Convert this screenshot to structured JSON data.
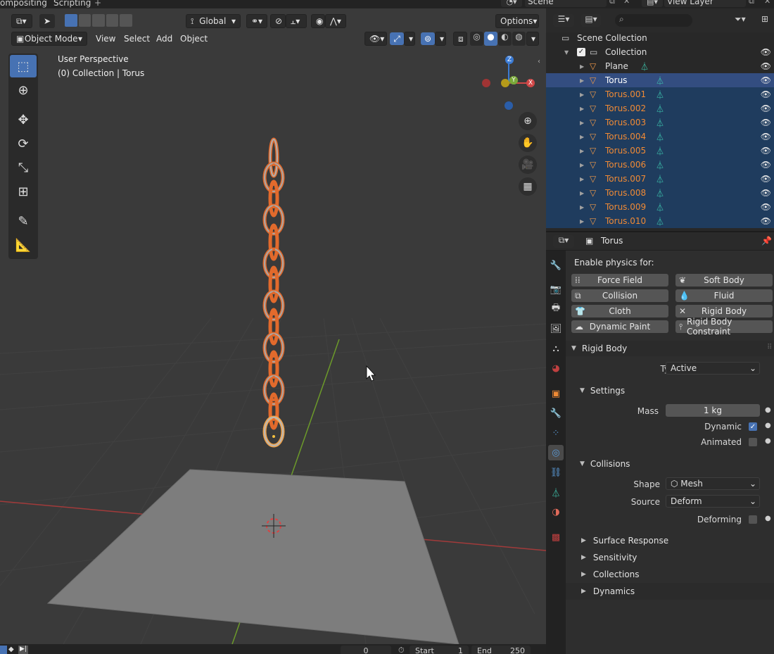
{
  "workspace_tabs": [
    "ompositing",
    "Scripting"
  ],
  "top_right": {
    "scene": "Scene",
    "view_layer": "View Layer"
  },
  "viewport": {
    "mode": "Object Mode",
    "menus": [
      "View",
      "Select",
      "Add",
      "Object"
    ],
    "transform_orientation": "Global",
    "options": "Options",
    "perspective_label": "User Perspective",
    "collection_label": "(0) Collection | Torus",
    "gizmo_axes": {
      "z": "Z",
      "y": "Y",
      "x": "X"
    }
  },
  "timeline": {
    "frame": "0",
    "start_label": "Start",
    "start": "1",
    "end_label": "End",
    "end": "250"
  },
  "outliner": {
    "root": "Scene Collection",
    "collection": "Collection",
    "items": [
      {
        "name": "Plane",
        "state": "normal"
      },
      {
        "name": "Torus",
        "state": "active"
      },
      {
        "name": "Torus.001",
        "state": "selected"
      },
      {
        "name": "Torus.002",
        "state": "selected"
      },
      {
        "name": "Torus.003",
        "state": "selected"
      },
      {
        "name": "Torus.004",
        "state": "selected"
      },
      {
        "name": "Torus.005",
        "state": "selected"
      },
      {
        "name": "Torus.006",
        "state": "selected"
      },
      {
        "name": "Torus.007",
        "state": "selected"
      },
      {
        "name": "Torus.008",
        "state": "selected"
      },
      {
        "name": "Torus.009",
        "state": "selected"
      },
      {
        "name": "Torus.010",
        "state": "selected"
      }
    ]
  },
  "properties": {
    "object_name": "Torus",
    "enable_physics_label": "Enable physics for:",
    "physics_buttons": {
      "force_field": "Force Field",
      "soft_body": "Soft Body",
      "collision": "Collision",
      "fluid": "Fluid",
      "cloth": "Cloth",
      "rigid_body": "Rigid Body",
      "dynamic_paint": "Dynamic Paint",
      "rigid_body_constraint": "Rigid Body Constraint"
    },
    "rigid_body_panel": "Rigid Body",
    "type_label": "Type",
    "type_value": "Active",
    "settings_panel": "Settings",
    "mass_label": "Mass",
    "mass_value": "1 kg",
    "dynamic_label": "Dynamic",
    "animated_label": "Animated",
    "collisions_panel": "Collisions",
    "shape_label": "Shape",
    "shape_value": "Mesh",
    "source_label": "Source",
    "source_value": "Deform",
    "deforming_label": "Deforming",
    "subpanels": [
      "Surface Response",
      "Sensitivity",
      "Collections",
      "Dynamics"
    ]
  },
  "colors": {
    "selection_blue": "#4772b3",
    "active_row": "#334d80",
    "selected_row": "#1f3c5e",
    "object_orange": "#f08a35",
    "mesh_data_teal": "#3fcfb5"
  }
}
